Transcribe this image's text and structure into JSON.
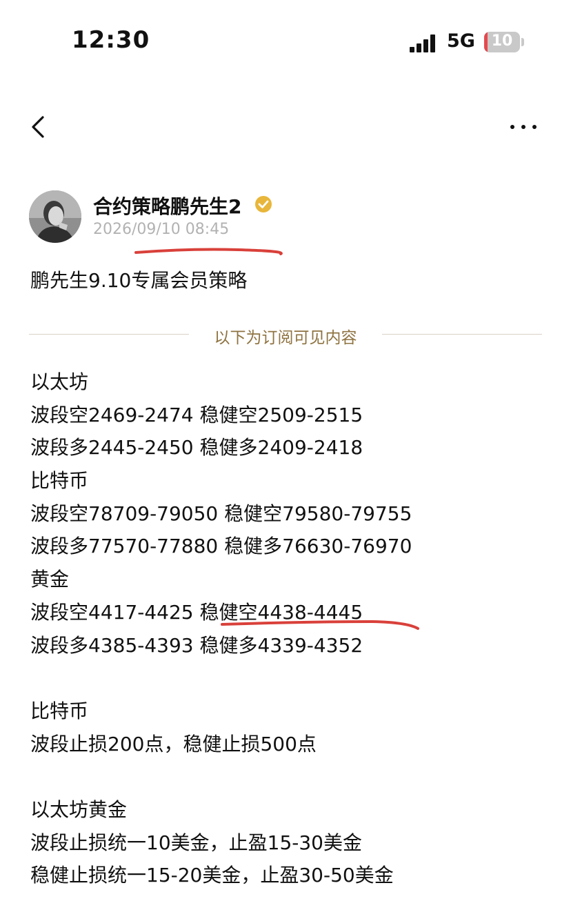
{
  "status_bar": {
    "time": "12:30",
    "network": "5G",
    "battery_level": "10",
    "battery_fill_fraction": 0.1,
    "battery_low_color": "#e5484d"
  },
  "nav": {
    "back_icon": "chevron-left-icon",
    "more_icon": "ellipsis-icon"
  },
  "post": {
    "author": "合约策略鹏先生2",
    "verified_icon": "verified-badge-icon",
    "verified_color": "#e8b63a",
    "timestamp": "2026/09/10 08:45",
    "title": "鹏先生9.10专属会员策略",
    "subscription_divider": "以下为订阅可见内容",
    "accent_color": "#8e7340"
  },
  "content": {
    "lines": [
      "以太坊",
      "波段空2469-2474 稳健空2509-2515",
      "波段多2445-2450 稳健多2409-2418",
      "比特币",
      "波段空78709-79050 稳健空79580-79755",
      "波段多77570-77880 稳健多76630-76970",
      "黄金",
      "波段空4417-4425 稳健空4438-4445",
      "波段多4385-4393 稳健多4339-4352",
      "",
      "比特币",
      "波段止损200点，稳健止损500点",
      "",
      "以太坊黄金",
      "波段止损统一10美金，止盈15-30美金",
      "稳健止损统一15-20美金，止盈30-50美金"
    ]
  },
  "annotations": {
    "underline_color": "#d9403a"
  }
}
